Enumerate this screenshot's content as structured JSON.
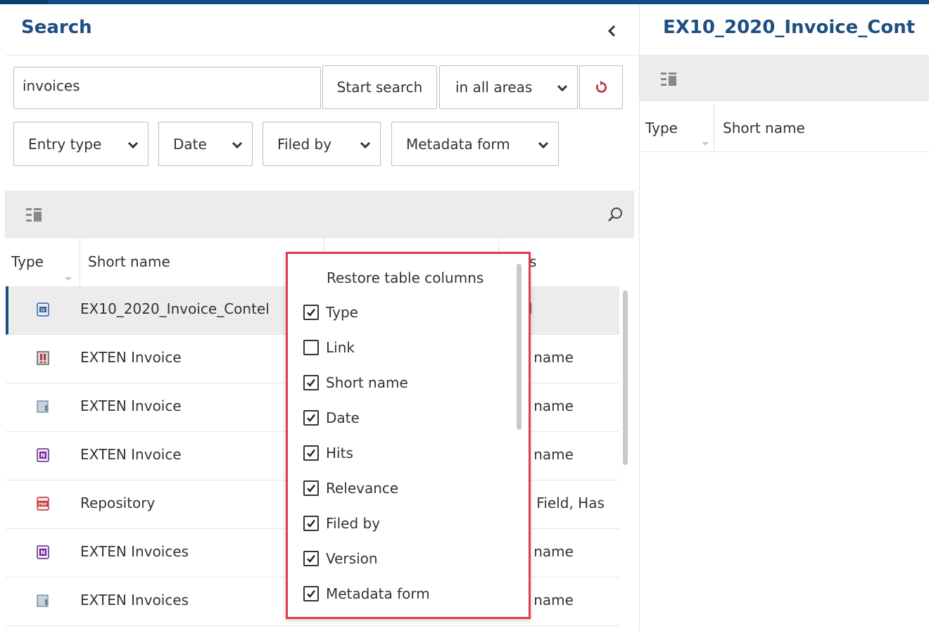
{
  "search_panel": {
    "title": "Search",
    "query_value": "invoices",
    "start_search_label": "Start search",
    "scope_value": "in all areas",
    "filters": [
      "Entry type",
      "Date",
      "Filed by",
      "Metadata form"
    ]
  },
  "results_table": {
    "columns": [
      "Type",
      "Short name"
    ],
    "rows": [
      {
        "icon": "word-document-icon",
        "name": "EX10_2020_Invoice_Contel",
        "hits": "d"
      },
      {
        "icon": "app-form-icon",
        "name": "EXTEN Invoice",
        "hits": "t name"
      },
      {
        "icon": "folder-binder-icon",
        "name": "EXTEN Invoice",
        "hits": "t name"
      },
      {
        "icon": "onenote-icon",
        "name": "EXTEN Invoice",
        "hits": "t name"
      },
      {
        "icon": "pdf-icon",
        "name": "Repository",
        "hits": "l, Field, Has"
      },
      {
        "icon": "onenote-icon",
        "name": "EXTEN Invoices",
        "hits": "t name"
      },
      {
        "icon": "folder-binder-icon",
        "name": "EXTEN Invoices",
        "hits": "t name"
      }
    ]
  },
  "column_popup": {
    "title": "Restore table columns",
    "options": [
      {
        "label": "Type",
        "checked": true
      },
      {
        "label": "Link",
        "checked": false
      },
      {
        "label": "Short name",
        "checked": true
      },
      {
        "label": "Date",
        "checked": true
      },
      {
        "label": "Hits",
        "checked": true
      },
      {
        "label": "Relevance",
        "checked": true
      },
      {
        "label": "Filed by",
        "checked": true
      },
      {
        "label": "Version",
        "checked": true
      },
      {
        "label": "Metadata form",
        "checked": true
      }
    ]
  },
  "detail_panel": {
    "title": "EX10_2020_Invoice_Cont",
    "columns": [
      "Type",
      "Short name"
    ]
  },
  "colors": {
    "accent": "#1d4f82",
    "topbar": "#104c85",
    "popup_border": "#e03c48",
    "reset_icon": "#c0303a"
  }
}
